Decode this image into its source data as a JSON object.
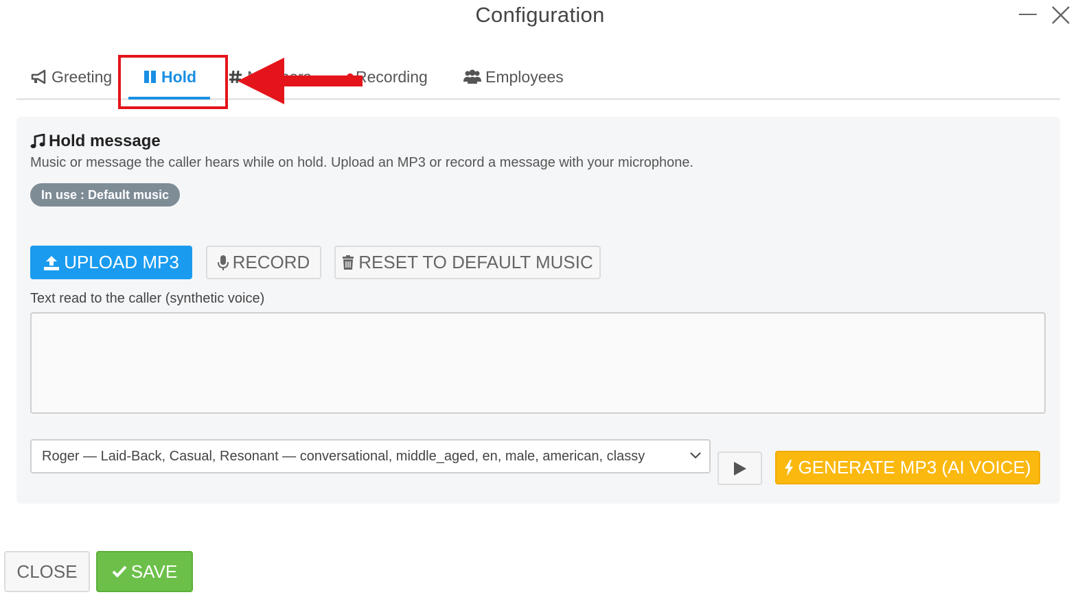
{
  "window": {
    "title": "Configuration"
  },
  "tabs": [
    {
      "label": "Greeting",
      "icon": "megaphone-icon"
    },
    {
      "label": "Hold",
      "icon": "pause-icon",
      "active": true
    },
    {
      "label": "Numbers",
      "icon": "hash-icon"
    },
    {
      "label": "Recording",
      "icon": "record-dot-icon"
    },
    {
      "label": "Employees",
      "icon": "users-icon"
    }
  ],
  "hold": {
    "title": "Hold message",
    "description": "Music or message the caller hears while on hold. Upload an MP3 or record a message with your microphone.",
    "badge": "In use : Default music",
    "upload_label": "UPLOAD MP3",
    "record_label": "RECORD",
    "reset_label": "RESET TO DEFAULT MUSIC",
    "text_label": "Text read to the caller (synthetic voice)",
    "text_value": "",
    "voice_selected": "Roger — Laid-Back, Casual, Resonant — conversational, middle_aged, en, male, american, classy",
    "generate_label": "GENERATE MP3 (AI VOICE)"
  },
  "footer": {
    "close_label": "CLOSE",
    "save_label": "SAVE"
  },
  "colors": {
    "accent": "#1a8fe3",
    "upload": "#1a9bf0",
    "generate": "#fbb80e",
    "save": "#6cc04a",
    "badge": "#7e8c96",
    "annotation": "#e4141b"
  }
}
